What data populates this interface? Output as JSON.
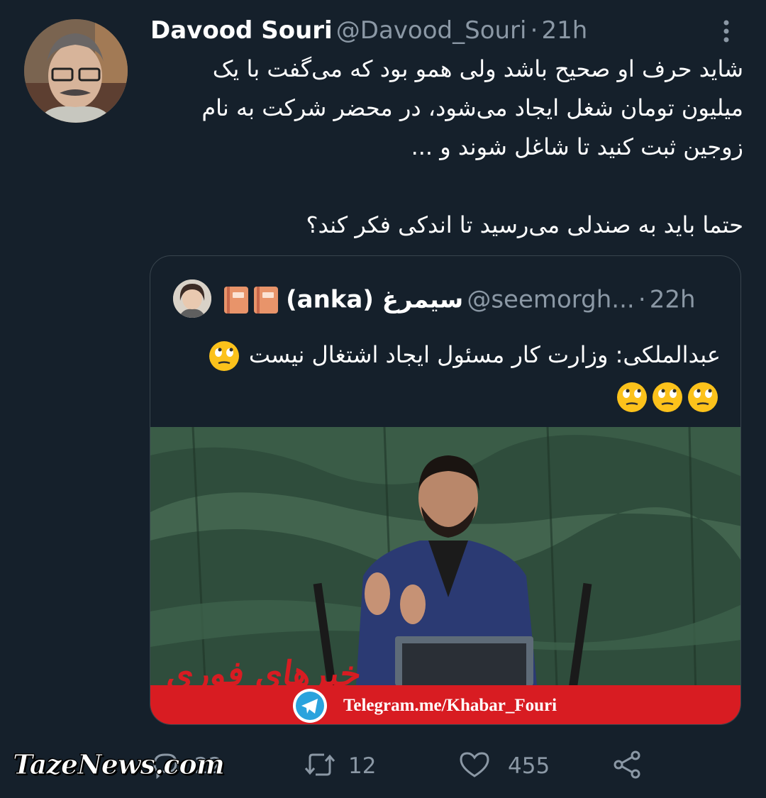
{
  "tweet": {
    "author": {
      "display_name": "Davood Souri",
      "handle": "@Davood_Souri",
      "separator": "·",
      "time": "21h"
    },
    "text": "شاید حرف او صحیح باشد ولی همو بود که می‌گفت با یک میلیون تومان شغل ایجاد می‌شود، در محضر شرکت به نام زوجین ثبت کنید تا شاغل شوند و ...\n\nحتما باید به صندلی می‌رسید تا اندکی فکر کند؟",
    "more_icon": "more-vertical-icon"
  },
  "quote": {
    "author": {
      "display_name": "سیمرغ (anka)",
      "handle": "@seemorgh...",
      "separator": "·",
      "time": "22h",
      "name_emoji": [
        "book-icon",
        "book-icon"
      ]
    },
    "text_main": "عبدالملکی: وزارت کار مسئول ایجاد اشتغال نیست",
    "emoji_icon": "face-with-rolling-eyes-icon",
    "image": {
      "banner_text": "Telegram.me/Khabar_Fouri",
      "logo_text": "خبرهای فوری",
      "telegram_icon": "telegram-icon"
    }
  },
  "actions": {
    "reply": {
      "icon": "reply-icon",
      "count": "22"
    },
    "retweet": {
      "icon": "retweet-icon",
      "count": "12"
    },
    "like": {
      "icon": "heart-icon",
      "count": "455"
    },
    "share": {
      "icon": "share-icon"
    }
  },
  "watermark": {
    "text": "TazeNews.com"
  },
  "colors": {
    "background": "#15202b",
    "secondary_text": "#8b98a5",
    "border": "#38444d",
    "banner_red": "#d81c22"
  }
}
